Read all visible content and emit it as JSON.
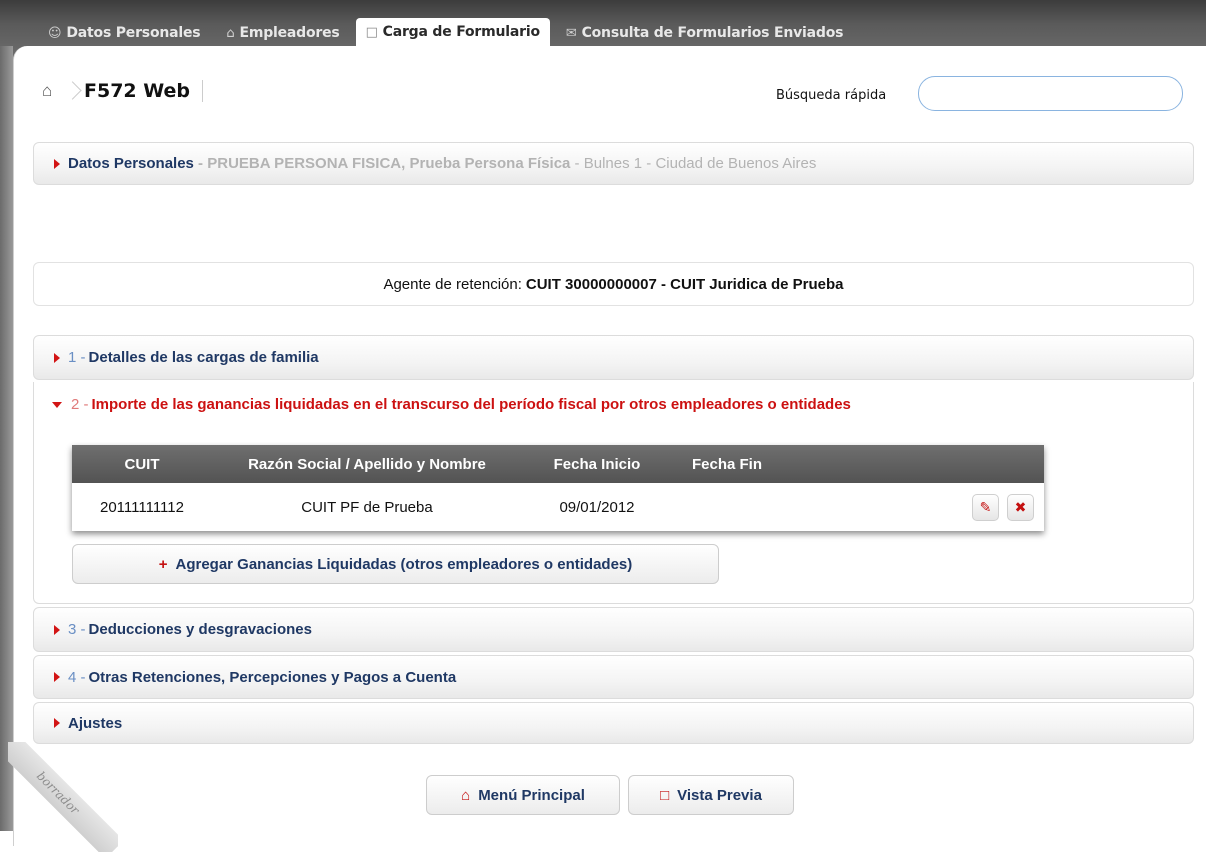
{
  "tabs": [
    {
      "icon": "person-icon",
      "label": "Datos Personales"
    },
    {
      "icon": "building-icon",
      "label": "Empleadores"
    },
    {
      "icon": "document-icon",
      "label": "Carga de Formulario"
    },
    {
      "icon": "mail-icon",
      "label": "Consulta de Formularios Enviados"
    }
  ],
  "header": {
    "title": "F572 Web",
    "search_label": "Búsqueda rápida",
    "search_value": ""
  },
  "personal": {
    "label": "Datos Personales",
    "sep": " - ",
    "name": "PRUEBA PERSONA FISICA, Prueba Persona Física",
    "address": "Bulnes 1 - Ciudad de Buenos Aires"
  },
  "agent": {
    "prefix": "Agente de retención:",
    "value": "CUIT 30000000007 - CUIT Juridica de Prueba"
  },
  "sections": [
    {
      "num": "1 -",
      "label": "Detalles de las cargas de familia"
    },
    {
      "num": "2 -",
      "label": "Importe de las ganancias liquidadas en el transcurso del período fiscal por otros empleadores o entidades"
    },
    {
      "num": "3 -",
      "label": "Deducciones y desgravaciones"
    },
    {
      "num": "4 -",
      "label": "Otras Retenciones, Percepciones y Pagos a Cuenta"
    },
    {
      "num": "",
      "label": "Ajustes"
    }
  ],
  "table": {
    "columns": [
      "CUIT",
      "Razón Social / Apellido y Nombre",
      "Fecha Inicio",
      "Fecha Fin"
    ],
    "rows": [
      {
        "cuit": "20111111112",
        "razon": "CUIT PF de Prueba",
        "inicio": "09/01/2012",
        "fin": ""
      }
    ]
  },
  "add_button": "Agregar Ganancias Liquidadas (otros empleadores o entidades)",
  "footer": {
    "menu_button": "Menú Principal",
    "preview_button": "Vista Previa"
  },
  "watermark": "borrador",
  "colors": {
    "accent_red": "#cc1111",
    "link_blue": "#1f3864",
    "header_gray": "#535353"
  }
}
